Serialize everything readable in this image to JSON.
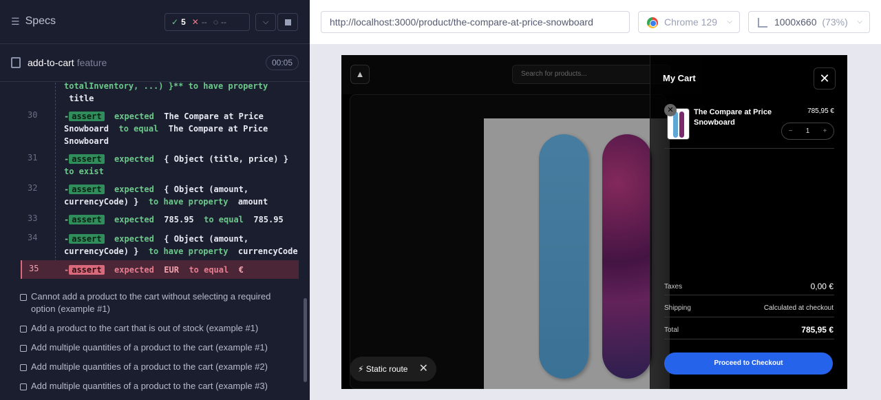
{
  "specs": {
    "title": "Specs",
    "passed": "5",
    "failed": "--",
    "pending": "--"
  },
  "spec": {
    "name": "add-to-cart",
    "type": "feature",
    "timer": "00:05"
  },
  "commands": [
    {
      "num": "",
      "text1": "totalInventory, ...) }** to have property",
      "text2": "title"
    },
    {
      "num": "30",
      "pre": "-",
      "badge": "assert",
      "parts": [
        "expected",
        "The Compare at Price Snowboard",
        "to equal",
        "The Compare at Price Snowboard"
      ]
    },
    {
      "num": "31",
      "pre": "-",
      "badge": "assert",
      "parts": [
        "expected",
        "{ Object (title, price) }",
        "to exist"
      ]
    },
    {
      "num": "32",
      "pre": "-",
      "badge": "assert",
      "parts": [
        "expected",
        "{ Object (amount, currencyCode) }",
        "to have property",
        "amount"
      ]
    },
    {
      "num": "33",
      "pre": "-",
      "badge": "assert",
      "parts": [
        "expected",
        "785.95",
        "to equal",
        "785.95"
      ]
    },
    {
      "num": "34",
      "pre": "-",
      "badge": "assert",
      "parts": [
        "expected",
        "{ Object (amount, currencyCode) }",
        "to have property",
        "currencyCode"
      ]
    },
    {
      "num": "35",
      "pre": "-",
      "badge": "assert",
      "parts": [
        "expected",
        "EUR",
        "to equal",
        "€"
      ]
    }
  ],
  "tests": [
    "Cannot add a product to the cart without selecting a required option (example #1)",
    "Add a product to the cart that is out of stock (example #1)",
    "Add multiple quantities of a product to the cart (example #1)",
    "Add multiple quantities of a product to the cart (example #2)",
    "Add multiple quantities of a product to the cart (example #3)"
  ],
  "browser": {
    "url": "http://localhost:3000/product/the-compare-at-price-snowboard",
    "name": "Chrome 129",
    "viewport": "1000x660",
    "scale": "(73%)"
  },
  "store": {
    "logo": "▲",
    "search_placeholder": "Search for products...",
    "static_route": "Static route",
    "cart": {
      "title": "My Cart",
      "item_name": "The Compare at Price Snowboard",
      "item_price": "785,95 €",
      "qty": "1",
      "taxes_label": "Taxes",
      "taxes_value": "0,00 €",
      "shipping_label": "Shipping",
      "shipping_value": "Calculated at checkout",
      "total_label": "Total",
      "total_value": "785,95 €",
      "checkout_label": "Proceed to Checkout"
    }
  },
  "colors": {
    "pass": "#6cc98b",
    "fail": "#d9697b",
    "checkout": "#2563eb"
  }
}
